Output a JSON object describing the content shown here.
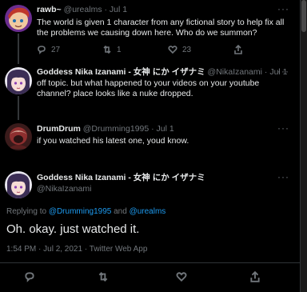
{
  "tweets": [
    {
      "name": "rawb~",
      "handle": "@urealms",
      "time": "· Jul 1",
      "text": "The world is given 1 character from any fictional story to help fix all the problems we causing down here. Who do we summon?",
      "replies": "27",
      "retweets": "1",
      "likes": "23"
    },
    {
      "name": "Goddess Nika Izanami - 女神 にか イザナミ",
      "handle": "@NikaIzanami",
      "time": "· Jul 1",
      "text": "off topic. but what happened to your videos on your youtube channel? place looks like a nuke dropped."
    },
    {
      "name": "DrumDrum",
      "handle": "@Drumming1995",
      "time": "· Jul 1",
      "text": "if you watched his latest one, youd know."
    }
  ],
  "focused": {
    "name": "Goddess Nika Izanami - 女神 にか イザナミ",
    "handle": "@NikaIzanami",
    "reply_prefix": "Replying to ",
    "reply_user1": "@Drumming1995",
    "reply_and": " and ",
    "reply_user2": "@urealms",
    "text": "Oh. okay. just watched it.",
    "timestamp": "1:54 PM · Jul 2, 2021 · Twitter Web App"
  },
  "more_label": "···",
  "colors": {
    "background": "#000000",
    "text": "#e7e9ea",
    "muted": "#71767b",
    "link": "#1d9bf0",
    "border": "#2f3336"
  }
}
